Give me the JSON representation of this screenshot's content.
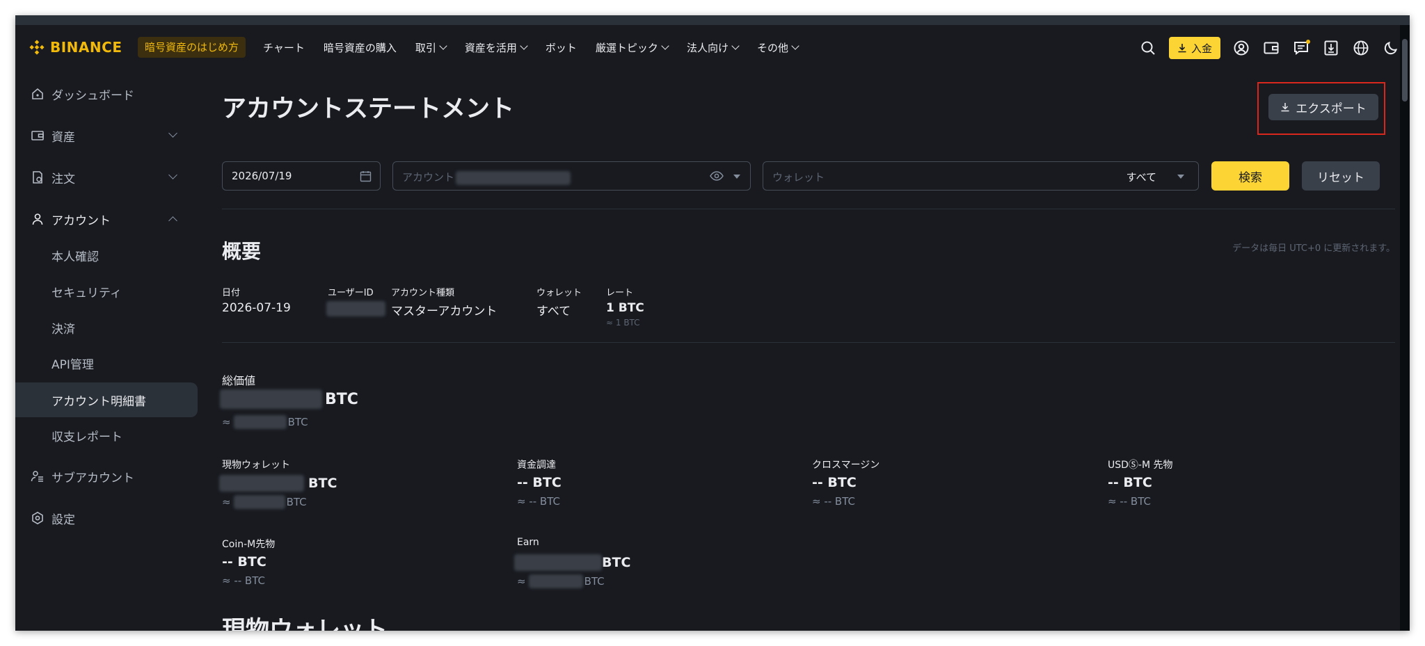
{
  "header": {
    "logo_text": "BINANCE",
    "beginner_label": "暗号資産のはじめ方",
    "nav": [
      {
        "label": "チャート",
        "dropdown": false
      },
      {
        "label": "暗号資産の購入",
        "dropdown": false
      },
      {
        "label": "取引",
        "dropdown": true
      },
      {
        "label": "資産を活用",
        "dropdown": true
      },
      {
        "label": "ボット",
        "dropdown": false
      },
      {
        "label": "厳選トピック",
        "dropdown": true
      },
      {
        "label": "法人向け",
        "dropdown": true
      },
      {
        "label": "その他",
        "dropdown": true
      }
    ],
    "deposit_label": "入金",
    "icons": [
      "search-icon",
      "user-icon",
      "wallet-icon",
      "message-icon",
      "download-app-icon",
      "globe-icon",
      "moon-icon"
    ]
  },
  "sidebar": {
    "items": [
      {
        "label": "ダッシュボード",
        "icon": "home-icon"
      },
      {
        "label": "資産",
        "icon": "wallet-icon",
        "expandable": true
      },
      {
        "label": "注文",
        "icon": "orders-icon",
        "expandable": true
      },
      {
        "label": "アカウント",
        "icon": "user-icon",
        "expandable": true,
        "expanded": true
      },
      {
        "label": "サブアカウント",
        "icon": "sub-account-icon"
      },
      {
        "label": "設定",
        "icon": "settings-icon"
      }
    ],
    "account_sub": [
      {
        "label": "本人確認"
      },
      {
        "label": "セキュリティ"
      },
      {
        "label": "決済"
      },
      {
        "label": "API管理"
      },
      {
        "label": "アカウント明細書",
        "active": true
      },
      {
        "label": "収支レポート"
      }
    ]
  },
  "main": {
    "title": "アカウントステートメント",
    "export_label": "エクスポート",
    "filters": {
      "date_value": "2026/07/19",
      "account_placeholder": "アカウント",
      "wallet_placeholder": "ウォレット",
      "wallet_value": "すべて",
      "search_label": "検索",
      "reset_label": "リセット"
    },
    "overview": {
      "title": "概要",
      "update_note": "データは毎日 UTC+0 に更新されます。",
      "date_label": "日付",
      "date_value": "2026-07-19",
      "userid_label": "ユーザーID",
      "account_type_label": "アカウント種類",
      "account_type_value": "マスターアカウント",
      "wallet_label": "ウォレット",
      "wallet_value": "すべて",
      "rate_label": "レート",
      "rate_value": "1 BTC",
      "rate_sub": "≈ 1 BTC",
      "total_label": "総価値",
      "unit": "BTC",
      "approx": "≈"
    },
    "wallets": [
      {
        "label": "現物ウォレット",
        "value": "",
        "approx": "",
        "blurred": true
      },
      {
        "label": "資金調達",
        "value": "-- BTC",
        "approx": "≈ -- BTC",
        "blurred": false
      },
      {
        "label": "クロスマージン",
        "value": "-- BTC",
        "approx": "≈ -- BTC",
        "blurred": false
      },
      {
        "label": "USDⓈ-M 先物",
        "value": "-- BTC",
        "approx": "≈ -- BTC",
        "blurred": false
      },
      {
        "label": "Coin-M先物",
        "value": "-- BTC",
        "approx": "≈ -- BTC",
        "blurred": false
      },
      {
        "label": "Earn",
        "value": "",
        "approx": "",
        "blurred": true
      }
    ],
    "spot_title": "現物ウォレット"
  }
}
